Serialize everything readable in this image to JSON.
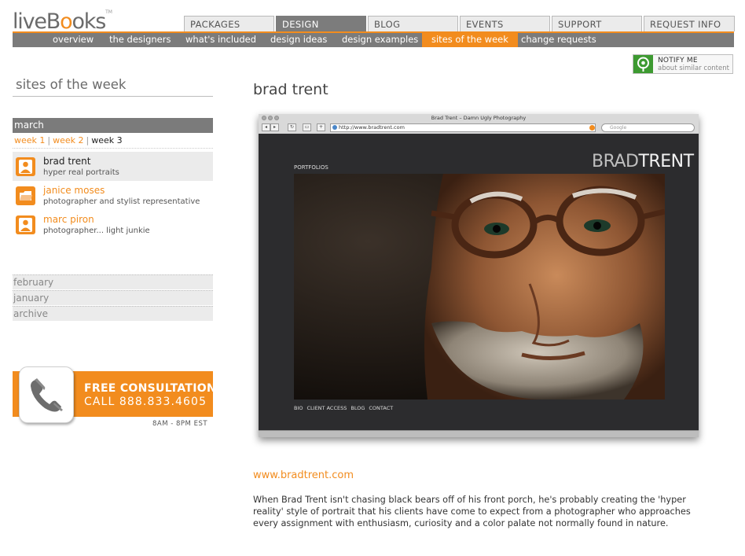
{
  "logo": {
    "text_a": "liveB",
    "text_o1": "o",
    "text_o2": "o",
    "text_b": "ks",
    "tm": "TM"
  },
  "tabs": [
    {
      "label": "PACKAGES",
      "active": false
    },
    {
      "label": "DESIGN",
      "active": true
    },
    {
      "label": "BLOG",
      "active": false
    },
    {
      "label": "EVENTS",
      "active": false
    },
    {
      "label": "SUPPORT",
      "active": false
    },
    {
      "label": "REQUEST INFO",
      "active": false
    }
  ],
  "subnav": [
    {
      "label": "overview"
    },
    {
      "label": "the designers"
    },
    {
      "label": "what's included"
    },
    {
      "label": "design ideas"
    },
    {
      "label": "design examples"
    },
    {
      "label": "sites of the week",
      "active": true
    },
    {
      "label": "change requests"
    }
  ],
  "notify": {
    "title": "NOTIFY ME",
    "subtitle": "about similar content"
  },
  "sidebar": {
    "title": "sites of the week",
    "month": "march",
    "weeks": [
      "week 1",
      "week 2",
      "week 3"
    ],
    "week_separator": "|",
    "sites": [
      {
        "name": "brad trent",
        "desc": "hyper real portraits",
        "icon": "person-icon"
      },
      {
        "name": "janice moses",
        "desc": "photographer and stylist representative",
        "icon": "folder-icon"
      },
      {
        "name": "marc piron",
        "desc": "photographer... light junkie",
        "icon": "person-icon"
      }
    ],
    "past": [
      "february",
      "january",
      "archive"
    ]
  },
  "consult": {
    "title": "FREE CONSULTATION",
    "phone": "CALL 888.833.4605",
    "hours": "8AM - 8PM EST"
  },
  "main": {
    "title": "brad trent",
    "browser": {
      "window_title": "Brad Trent – Damn Ugly Photography",
      "url": "http://www.bradtrent.com",
      "search_placeholder": "Google",
      "portfolios": "PORTFOLIOS",
      "brand_a": "BRAD",
      "brand_b": "TRENT",
      "nav": [
        "BIO",
        "CLIENT ACCESS",
        "BLOG",
        "CONTACT"
      ]
    },
    "site_link": "www.bradtrent.com",
    "description": "When Brad Trent isn't chasing black bears off of his front porch, he's probably creating the 'hyper reality' style of portrait that his clients have come to expect from a photographer who approaches every assignment with enthusiasm, curiosity and a color palate not normally found in nature."
  },
  "colors": {
    "accent": "#f28c1e",
    "nav_gray": "#7b7b7b",
    "notify_green": "#3d9a31"
  }
}
